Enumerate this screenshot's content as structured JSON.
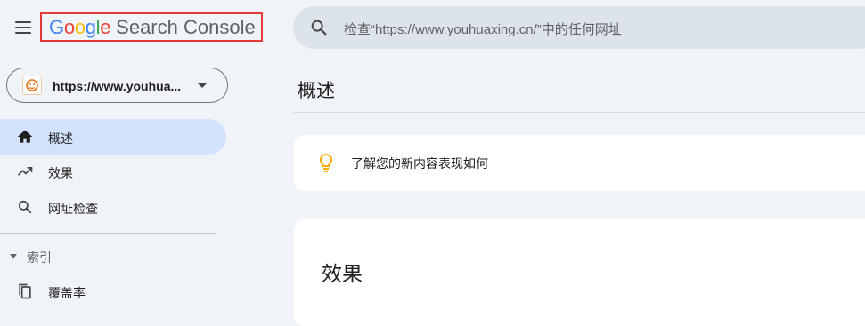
{
  "header": {
    "logo_google": "Google",
    "logo_product": "Search Console",
    "search_placeholder": "检查“https://www.youhuaxing.cn/”中的任何网址"
  },
  "sidebar": {
    "property": "https://www.youhua...",
    "items": [
      {
        "label": "概述",
        "icon": "home-icon",
        "active": true
      },
      {
        "label": "效果",
        "icon": "trending-up-icon",
        "active": false
      },
      {
        "label": "网址检查",
        "icon": "search-icon",
        "active": false
      }
    ],
    "section": "索引",
    "section_items": [
      {
        "label": "覆盖率",
        "icon": "file-copy-icon"
      }
    ]
  },
  "main": {
    "title": "概述",
    "tip": "了解您的新内容表现如何",
    "performance_title": "效果"
  },
  "colors": {
    "accent_active": "#d3e3fd",
    "search_bg": "#dde3ea",
    "highlight_border": "#e53935",
    "bulb": "#f9ab00"
  }
}
